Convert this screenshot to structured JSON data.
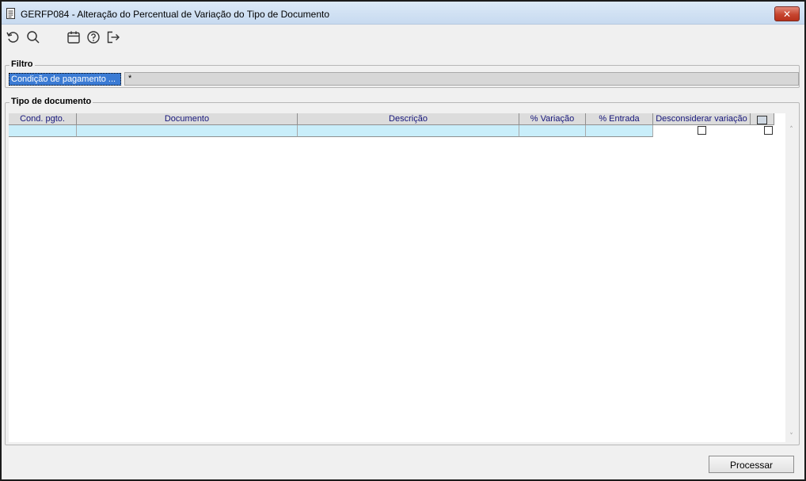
{
  "window": {
    "title": "GERFP084 - Alteração do Percentual de Variação do Tipo de Documento",
    "close_glyph": "✕"
  },
  "toolbar": {
    "buttons": [
      {
        "icon": "undo-icon"
      },
      {
        "icon": "search-icon"
      },
      {
        "icon": "calendar-icon"
      },
      {
        "icon": "help-icon"
      },
      {
        "icon": "exit-icon"
      }
    ]
  },
  "filter": {
    "group_label": "Filtro",
    "field_label": "Condição de pagamento ...",
    "field_value": "*"
  },
  "grid": {
    "group_label": "Tipo de documento",
    "columns": [
      "Cond. pgto.",
      "Documento",
      "Descrição",
      "% Variação",
      "% Entrada",
      "Desconsiderar variação"
    ],
    "rows": [
      {
        "cond_pgto": "",
        "documento": "",
        "descricao": "",
        "variacao": "",
        "entrada": "",
        "desconsiderar": false,
        "selected": false
      }
    ]
  },
  "actions": {
    "process_label": "Processar"
  },
  "colors": {
    "title_bar": "#c7daf0",
    "row_highlight": "#c9eefa",
    "header_text": "#15157a",
    "filter_label_bg": "#3b7bd4"
  }
}
